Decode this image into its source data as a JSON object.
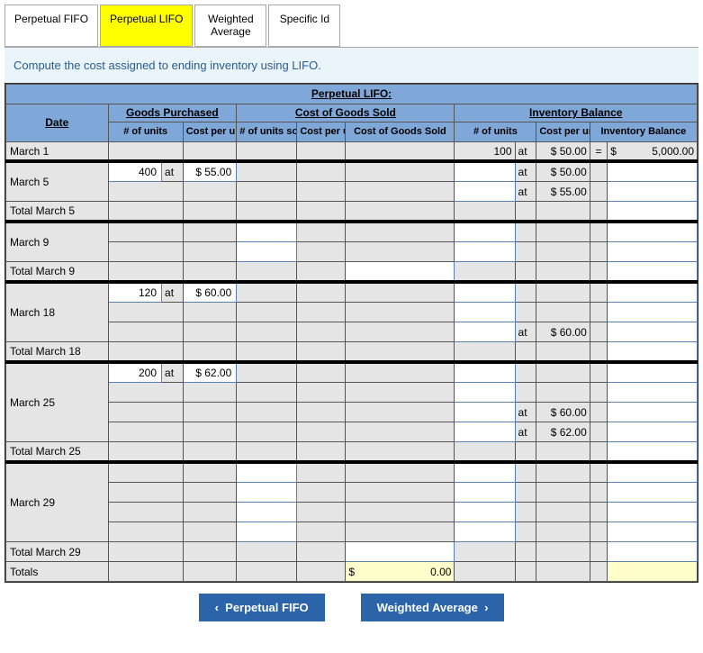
{
  "tabs": {
    "fifo": "Perpetual FIFO",
    "lifo": "Perpetual LIFO",
    "wavg": "Weighted\nAverage",
    "spec": "Specific Id"
  },
  "instruction": "Compute the cost assigned to ending inventory using LIFO.",
  "title": "Perpetual LIFO:",
  "headers": {
    "date": "Date",
    "gp": "Goods Purchased",
    "cogs": "Cost of Goods Sold",
    "ib": "Inventory Balance",
    "units": "# of units",
    "cpu": "Cost per unit",
    "units_sold": "# of units sold",
    "cogs_amt": "Cost of Goods Sold",
    "ib_amt": "Inventory Balance"
  },
  "rows": {
    "mar1": {
      "date": "March 1",
      "ib_units": "100",
      "ib_at": "at",
      "ib_cpu": "$ 50.00",
      "eq": "=",
      "ib_amt_prefix": "$",
      "ib_amt": "5,000.00"
    },
    "mar5": {
      "date": "March 5",
      "gp_units": "400",
      "gp_at": "at",
      "gp_cpu": "$ 55.00",
      "ibrow1_at": "at",
      "ibrow1_cpu": "$ 50.00",
      "ibrow2_at": "at",
      "ibrow2_cpu": "$ 55.00"
    },
    "tmar5": {
      "date": "Total March 5"
    },
    "mar9": {
      "date": "March 9"
    },
    "tmar9": {
      "date": "Total March 9"
    },
    "mar18": {
      "date": "March 18",
      "gp_units": "120",
      "gp_at": "at",
      "gp_cpu": "$ 60.00",
      "ibrow3_at": "at",
      "ibrow3_cpu": "$ 60.00"
    },
    "tmar18": {
      "date": "Total March 18"
    },
    "mar25": {
      "date": "March 25",
      "gp_units": "200",
      "gp_at": "at",
      "gp_cpu": "$ 62.00",
      "ibrow3_at": "at",
      "ibrow3_cpu": "$ 60.00",
      "ibrow4_at": "at",
      "ibrow4_cpu": "$ 62.00"
    },
    "tmar25": {
      "date": "Total March 25"
    },
    "mar29": {
      "date": "March 29"
    },
    "tmar29": {
      "date": "Total March 29"
    },
    "totals": {
      "date": "Totals",
      "cogs_prefix": "$",
      "cogs_amt": "0.00"
    }
  },
  "nav": {
    "prev_sym": "‹",
    "prev": "Perpetual FIFO",
    "next": "Weighted Average",
    "next_sym": "›"
  }
}
